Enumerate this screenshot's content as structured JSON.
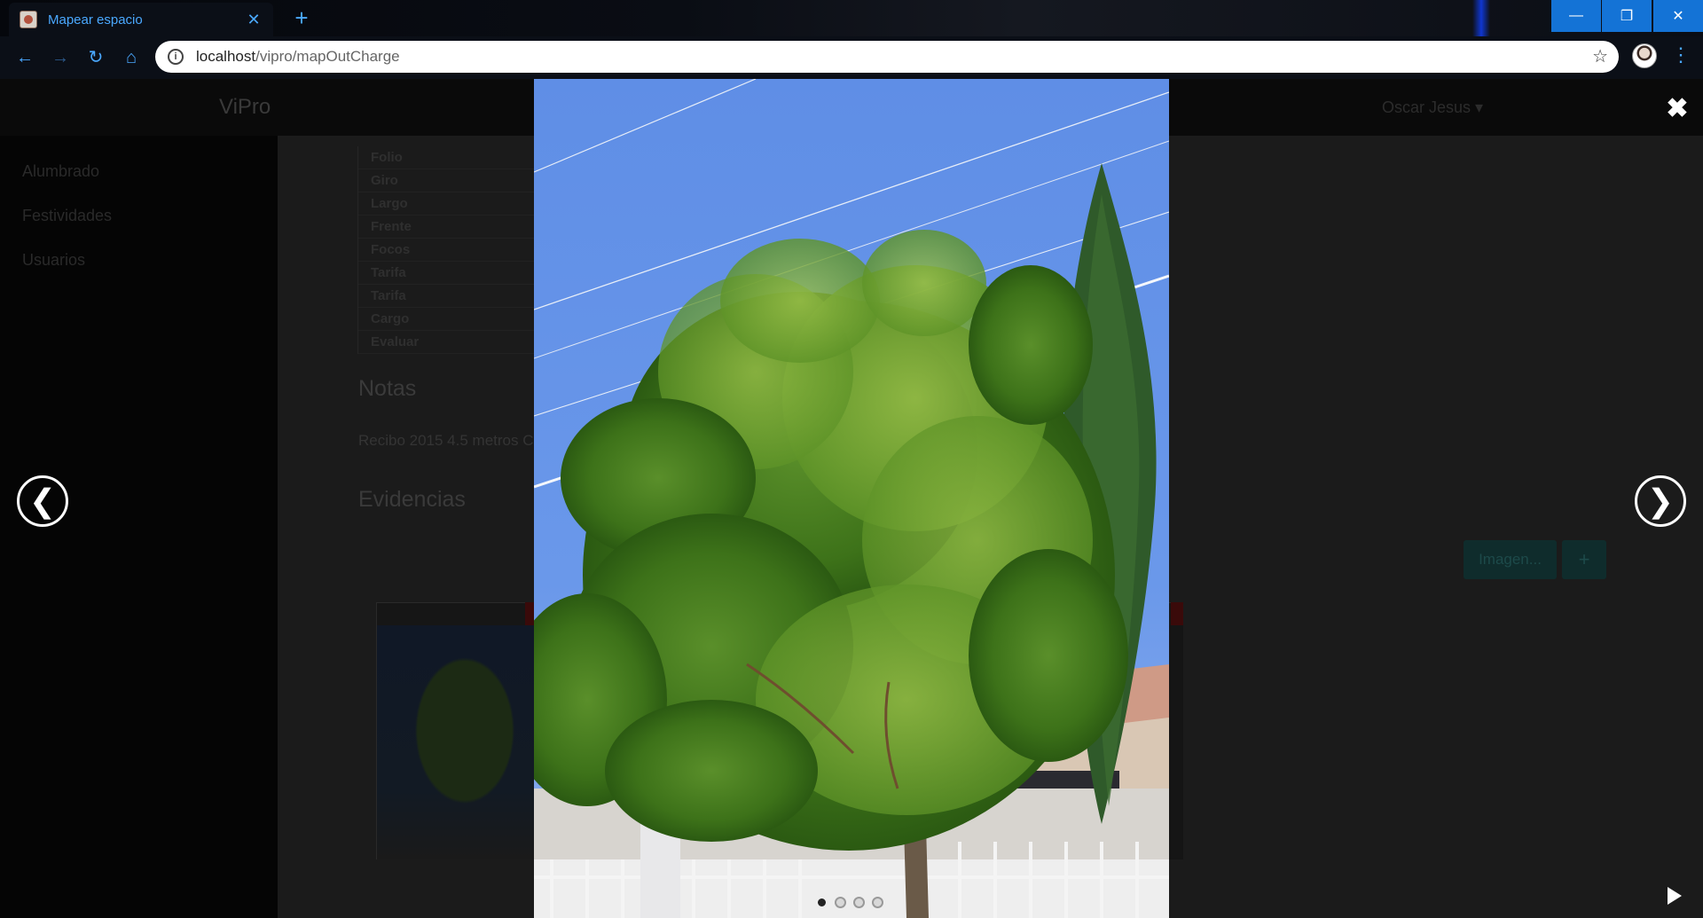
{
  "browser": {
    "tab_title": "Mapear espacio",
    "url_host": "localhost",
    "url_path": "/vipro/mapOutCharge",
    "icons": {
      "tab_close": "close-icon",
      "new_tab": "plus-icon",
      "back": "arrow-left-icon",
      "forward": "arrow-right-icon",
      "reload": "reload-icon",
      "home": "home-icon",
      "info": "info-icon",
      "bookmark": "star-icon",
      "menu": "kebab-menu-icon"
    },
    "glyphs": {
      "tab_close": "✕",
      "new_tab": "+",
      "back": "←",
      "forward": "→",
      "reload": "↻",
      "home": "⌂",
      "info": "i",
      "bookmark": "☆",
      "menu": "⋮",
      "minimize": "—",
      "maximize": "❐",
      "close": "✕"
    }
  },
  "app": {
    "brand": "ViPro",
    "user_menu": "Oscar Jesus ▾",
    "sidebar": [
      {
        "label": "Alumbrado"
      },
      {
        "label": "Festividades"
      },
      {
        "label": "Usuarios"
      }
    ],
    "fields": [
      "Folio",
      "Giro",
      "Largo",
      "Frente",
      "Focos",
      "Tarifa",
      "Tarifa",
      "Cargo",
      "Evaluar"
    ],
    "notas_heading": "Notas",
    "notas_text": "Recibo 2015 4.5 metros C",
    "evidencias_heading": "Evidencias",
    "image_button": "Imagen...",
    "add_button": "+"
  },
  "lightbox": {
    "close_glyph": "✖",
    "prev_glyph": "❮",
    "next_glyph": "❯",
    "slide_count": 4,
    "active_index": 0
  },
  "colors": {
    "accent": "#4aa8ff",
    "window_controls": "#1473d6",
    "sky": "#6e96e8",
    "foliage": "#3f7a1c"
  }
}
